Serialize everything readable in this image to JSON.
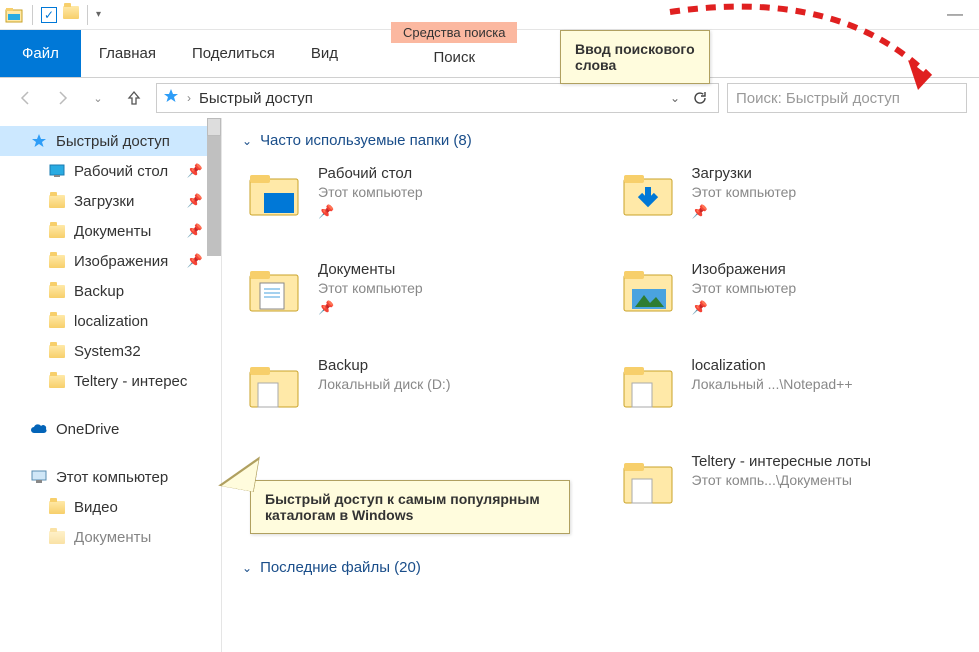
{
  "titlebar": {
    "app_icon": "explorer-icon"
  },
  "ribbon": {
    "file": "Файл",
    "tabs": [
      "Главная",
      "Поделиться",
      "Вид"
    ],
    "context_label": "Средства поиска",
    "context_tab": "Поиск"
  },
  "addressbar": {
    "crumb": "Быстрый доступ",
    "search_placeholder": "Поиск: Быстрый доступ"
  },
  "sidebar": {
    "quick_access": "Быстрый доступ",
    "items": [
      {
        "label": "Рабочий стол",
        "pinned": true,
        "icon": "desktop"
      },
      {
        "label": "Загрузки",
        "pinned": true,
        "icon": "downloads"
      },
      {
        "label": "Документы",
        "pinned": true,
        "icon": "documents"
      },
      {
        "label": "Изображения",
        "pinned": true,
        "icon": "pictures"
      },
      {
        "label": "Backup",
        "pinned": false,
        "icon": "folder"
      },
      {
        "label": "localization",
        "pinned": false,
        "icon": "folder"
      },
      {
        "label": "System32",
        "pinned": false,
        "icon": "folder"
      },
      {
        "label": "Teltery - интерес",
        "pinned": false,
        "icon": "folder"
      }
    ],
    "onedrive": "OneDrive",
    "thispc": "Этот компьютер",
    "pc_items": [
      {
        "label": "Видео",
        "icon": "videos"
      },
      {
        "label": "Документы",
        "icon": "documents"
      }
    ]
  },
  "content": {
    "group1_label": "Часто используемые папки (8)",
    "group2_label": "Последние файлы (20)",
    "folders": [
      {
        "name": "Рабочий стол",
        "loc": "Этот компьютер",
        "pinned": true,
        "icon": "desktop-big"
      },
      {
        "name": "Загрузки",
        "loc": "Этот компьютер",
        "pinned": true,
        "icon": "downloads-big"
      },
      {
        "name": "Документы",
        "loc": "Этот компьютер",
        "pinned": true,
        "icon": "documents-big"
      },
      {
        "name": "Изображения",
        "loc": "Этот компьютер",
        "pinned": true,
        "icon": "pictures-big"
      },
      {
        "name": "Backup",
        "loc": "Локальный диск (D:)",
        "pinned": false,
        "icon": "folder-big"
      },
      {
        "name": "localization",
        "loc": "Локальный ...\\Notepad++",
        "pinned": false,
        "icon": "folder-big"
      },
      {
        "name": "",
        "loc": "",
        "pinned": false,
        "icon": ""
      },
      {
        "name": "Teltery - интересные лоты",
        "loc": "Этот компь...\\Документы",
        "pinned": false,
        "icon": "folder-big"
      }
    ]
  },
  "callouts": {
    "search": "Ввод поискового слова",
    "quick": "Быстрый доступ к самым популярным каталогам в Windows"
  }
}
